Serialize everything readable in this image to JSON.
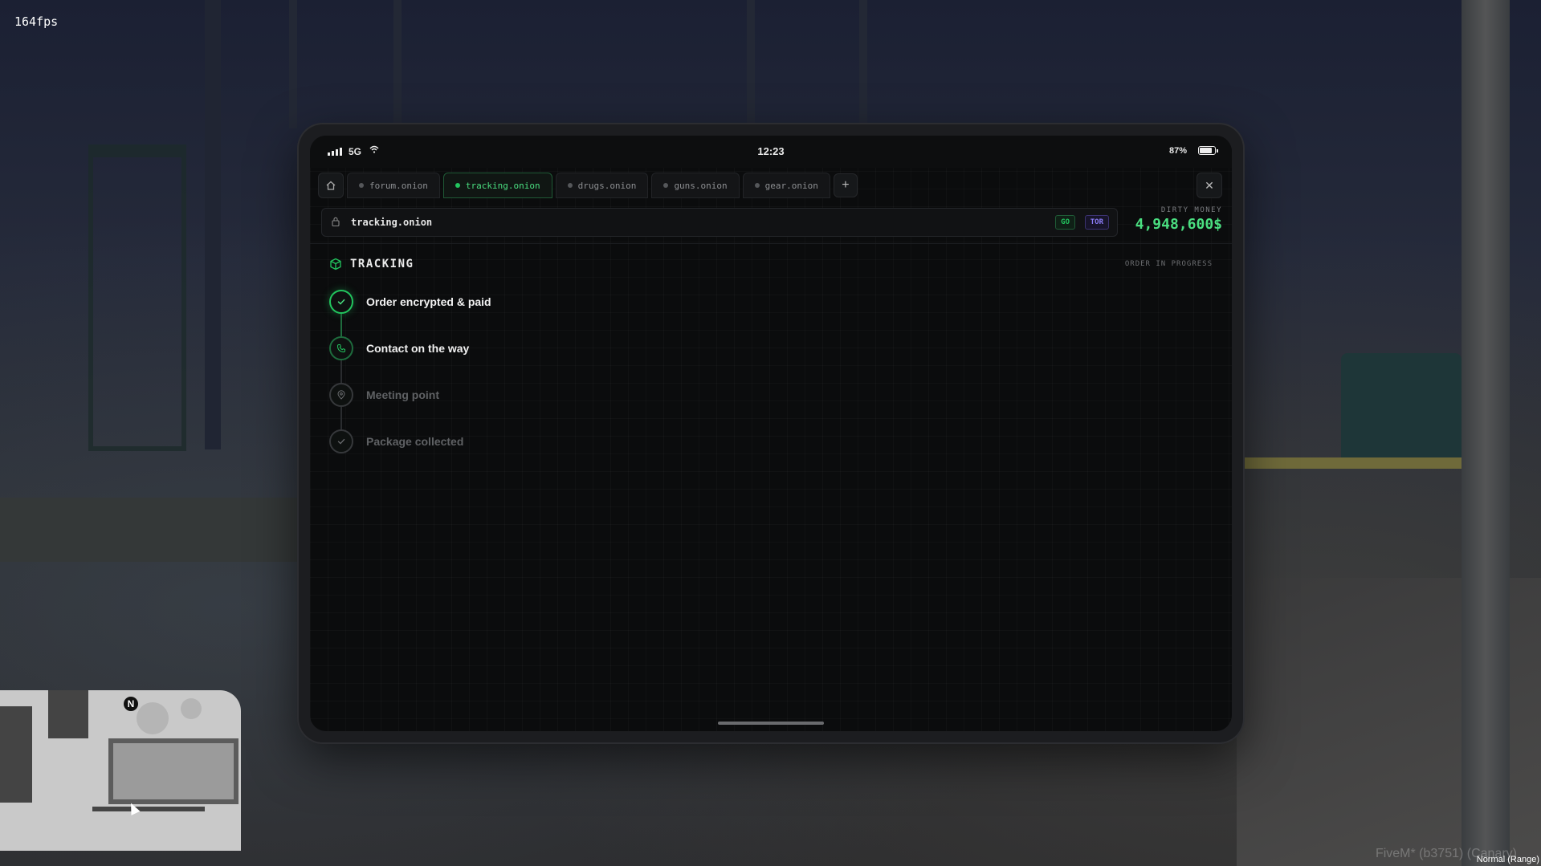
{
  "overlay": {
    "fps": "164fps",
    "watermark": "FiveM* (b3751) (Canary)",
    "voice_mode": "Normal (Range)",
    "minimap_north": "N"
  },
  "status_bar": {
    "network": "5G",
    "time": "12:23",
    "battery": "87%"
  },
  "tabs": [
    {
      "label": "forum.onion",
      "active": false
    },
    {
      "label": "tracking.onion",
      "active": true
    },
    {
      "label": "drugs.onion",
      "active": false
    },
    {
      "label": "guns.onion",
      "active": false
    },
    {
      "label": "gear.onion",
      "active": false
    }
  ],
  "address_bar": {
    "url": "tracking.onion",
    "go_label": "GO",
    "tor_label": "TOR"
  },
  "wallet": {
    "label": "DIRTY MONEY",
    "amount": "4,948,600$"
  },
  "tracking": {
    "title": "TRACKING",
    "status": "ORDER IN PROGRESS",
    "steps": [
      {
        "label": "Order encrypted & paid",
        "state": "done",
        "icon": "check-icon"
      },
      {
        "label": "Contact on the way",
        "state": "current",
        "icon": "phone-icon"
      },
      {
        "label": "Meeting point",
        "state": "pending",
        "icon": "map-pin-icon"
      },
      {
        "label": "Package collected",
        "state": "pending",
        "icon": "check-icon"
      }
    ]
  },
  "colors": {
    "accent": "#22c55e",
    "tor": "#8b7cf6",
    "screen_bg": "#0b0c0d"
  }
}
